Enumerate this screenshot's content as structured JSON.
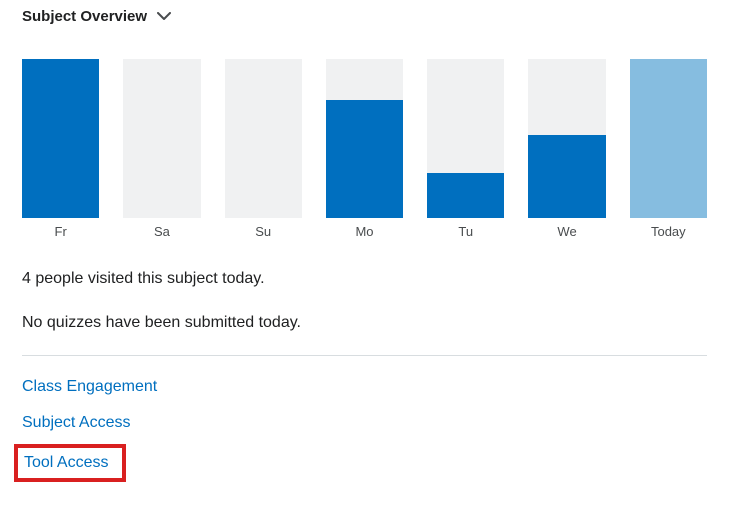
{
  "header": {
    "title": "Subject Overview"
  },
  "chart_data": {
    "type": "bar",
    "title": "",
    "xlabel": "",
    "ylabel": "",
    "ylim": [
      0,
      100
    ],
    "categories": [
      "Fr",
      "Sa",
      "Su",
      "Mo",
      "Tu",
      "We",
      "Today"
    ],
    "values": [
      100,
      0,
      0,
      74,
      28,
      52,
      100
    ],
    "colors": [
      "#006fbf",
      "#006fbf",
      "#006fbf",
      "#006fbf",
      "#006fbf",
      "#006fbf",
      "#86bde0"
    ],
    "track_color": "#f0f1f2"
  },
  "stats": {
    "visits": "4 people visited this subject today.",
    "quizzes": "No quizzes have been submitted today."
  },
  "links": {
    "class_engagement": "Class Engagement",
    "subject_access": "Subject Access",
    "tool_access": "Tool Access"
  },
  "highlight": {
    "target": "tool-access-link",
    "color": "#d92020"
  }
}
